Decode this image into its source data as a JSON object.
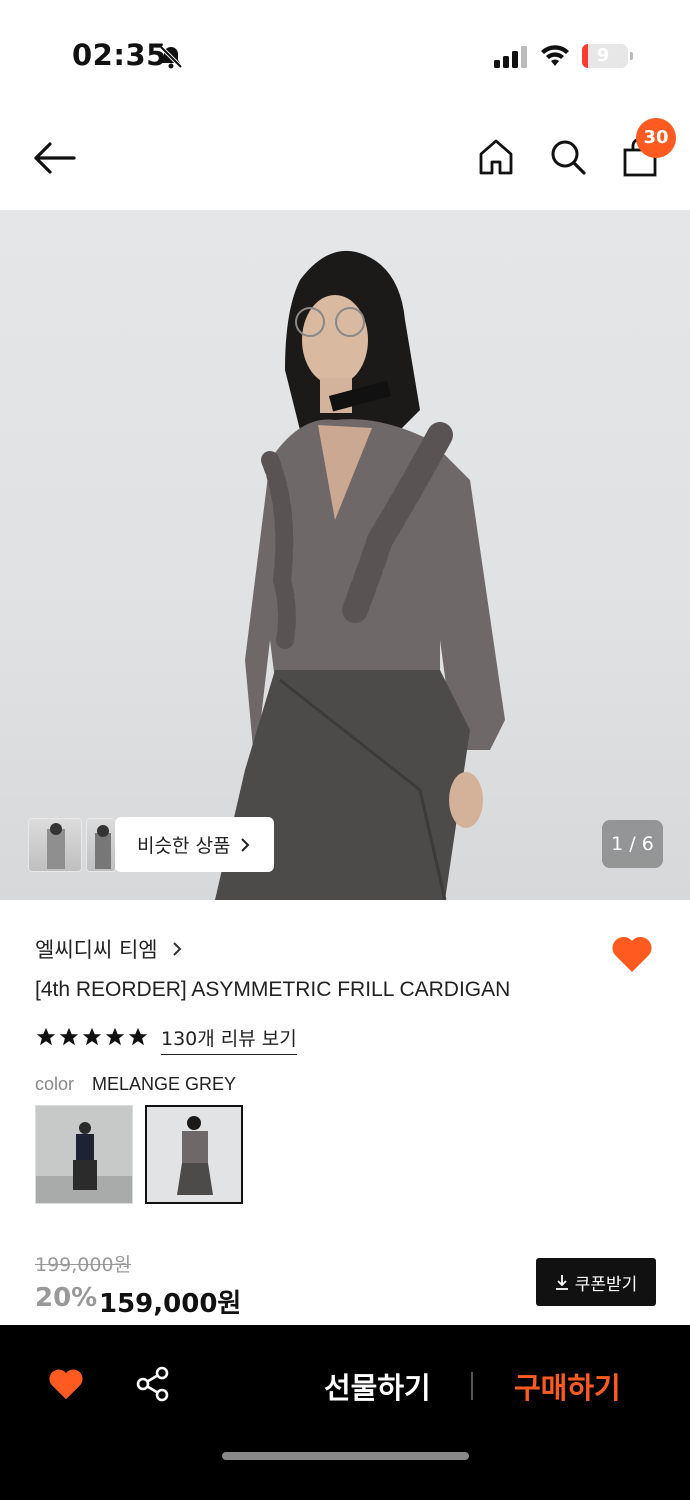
{
  "status": {
    "time": "02:35",
    "battery": "9"
  },
  "nav": {
    "cart_badge": "30"
  },
  "hero": {
    "similar_label": "비슷한 상품",
    "counter": "1 / 6"
  },
  "product": {
    "brand": "엘씨디씨 티엠",
    "title": "[4th REORDER] ASYMMETRIC FRILL CARDIGAN",
    "reviews": "130개 리뷰 보기",
    "color_label": "color",
    "color_value": "MELANGE GREY",
    "rating_stars": 5
  },
  "price": {
    "original": "199,000원",
    "discount": "20%",
    "current": "159,000원",
    "coupon_label": "쿠폰받기"
  },
  "bottom": {
    "gift_label": "선물하기",
    "buy_label": "구매하기"
  },
  "colors": {
    "accent": "#ff5a1f",
    "bar": "#000000"
  }
}
